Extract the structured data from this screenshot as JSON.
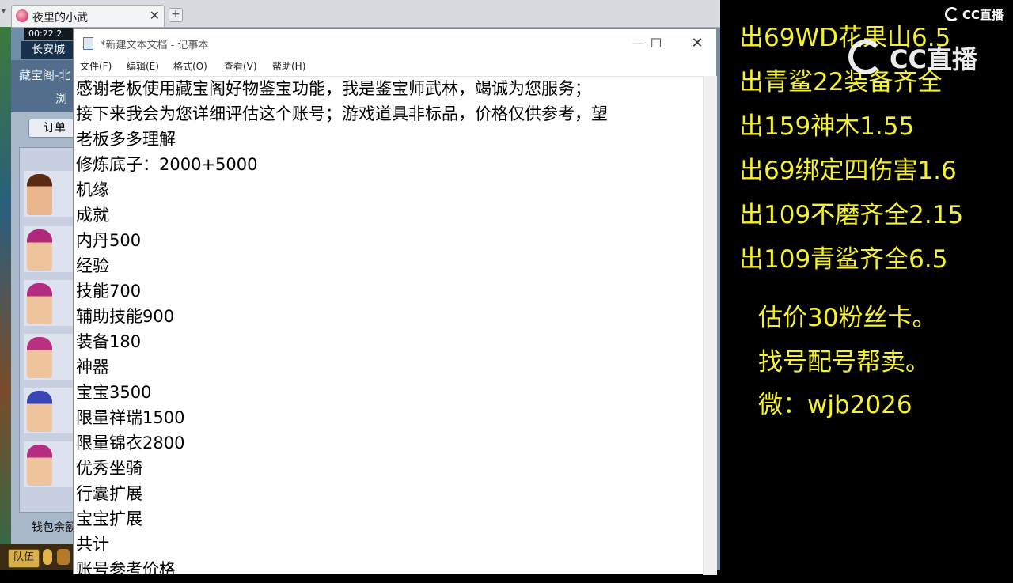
{
  "browser": {
    "tab_title": "夜里的小武",
    "tab_close": "✕",
    "new_tab": "+"
  },
  "game": {
    "clock": "00:22:2",
    "city": "长安城",
    "panel_title": "藏宝阁-北",
    "panel_browse": "浏",
    "order_button": "订单",
    "wallet_label": "钱包余额",
    "team_button": "队伍"
  },
  "notepad": {
    "title": "*新建文本文档 - 记事本",
    "controls": {
      "minimize": "—",
      "maximize": "☐",
      "close": "✕"
    },
    "menu": [
      "文件(F)",
      "编辑(E)",
      "格式(O)",
      "查看(V)",
      "帮助(H)"
    ],
    "lines": [
      "感谢老板使用藏宝阁好物鉴宝功能，我是鉴宝师武林，竭诚为您服务；",
      "接下来我会为您详细评估这个账号；游戏道具非标品，价格仅供参考，望",
      "老板多多理解",
      "修炼底子：2000+5000",
      "机缘",
      "成就",
      "内丹500",
      "经验",
      "技能700",
      "辅助技能900",
      "装备180",
      "神器",
      "宝宝3500",
      "限量祥瑞1500",
      "限量锦衣2800",
      "优秀坐骑",
      "行囊扩展",
      "宝宝扩展",
      "共计",
      "账号参考价格"
    ]
  },
  "overlay": {
    "sales": [
      "出69WD花果山6.5",
      "出青鲨22装备齐全",
      "出159神木1.55",
      "出69绑定四伤害1.6",
      "出109不磨齐全2.15",
      "出109青鲨齐全6.5"
    ],
    "info": [
      "估价30粉丝卡。",
      "找号配号帮卖。",
      "微：wjb2026"
    ],
    "logo_small": "CC直播",
    "logo_big": "CC直播",
    "text_color": "#f5f030"
  }
}
